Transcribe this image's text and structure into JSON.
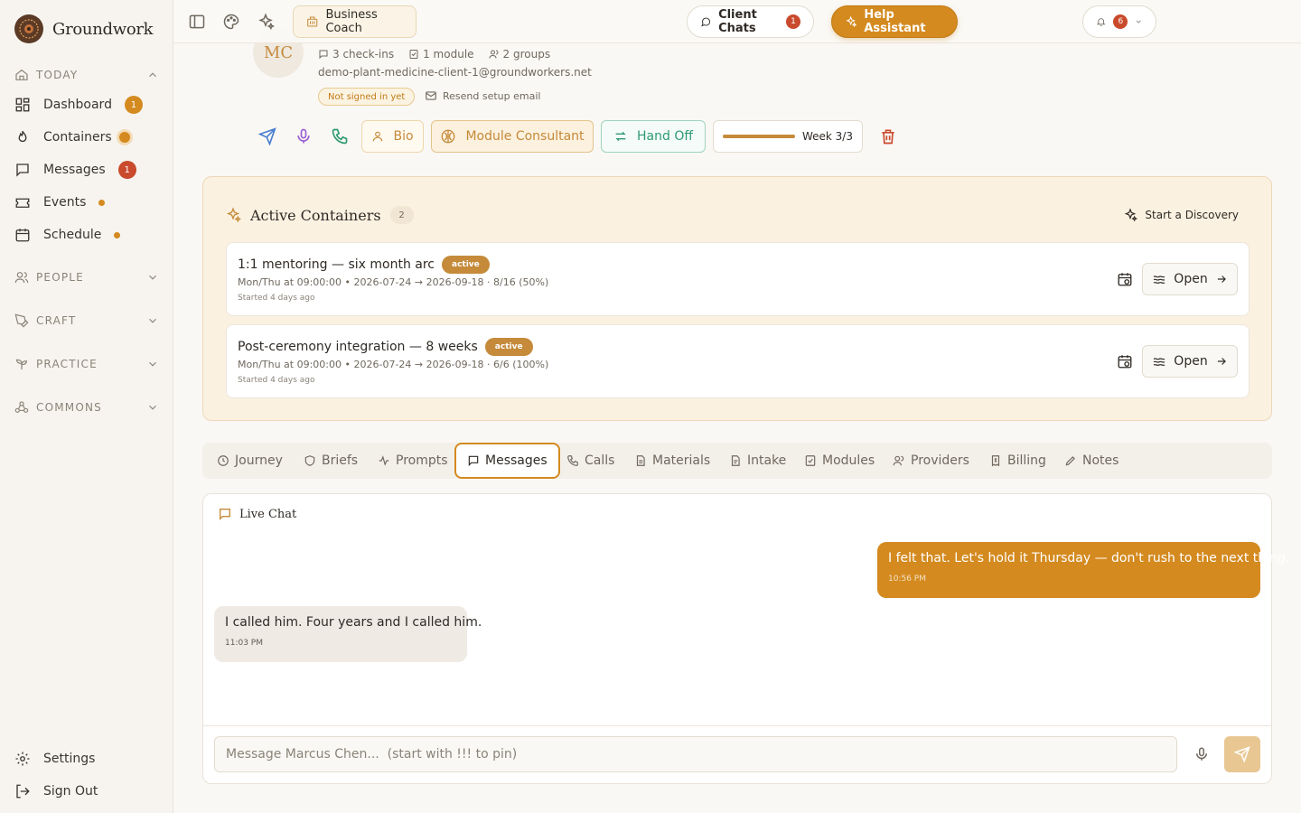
{
  "brand": {
    "name": "Groundwork"
  },
  "sidebar": {
    "sections": {
      "today": "TODAY",
      "people": "PEOPLE",
      "craft": "CRAFT",
      "practice": "PRACTICE",
      "commons": "COMMONS"
    },
    "items": [
      {
        "label": "Dashboard",
        "badge": "1"
      },
      {
        "label": "Containers"
      },
      {
        "label": "Messages",
        "badge": "1"
      },
      {
        "label": "Events"
      },
      {
        "label": "Schedule"
      }
    ],
    "footer": {
      "settings": "Settings",
      "signout": "Sign Out"
    }
  },
  "topbar": {
    "role": "Business Coach",
    "client_chats": "Client Chats",
    "client_chats_count": "1",
    "help": "Help Assistant",
    "notifications": "6"
  },
  "client": {
    "initials": "MC",
    "checkins": "3 check-ins",
    "modules": "1 module",
    "groups": "2 groups",
    "email": "demo-plant-medicine-client-1@groundworkers.net",
    "status": "Not signed in yet",
    "resend": "Resend setup email"
  },
  "actions": {
    "bio": "Bio",
    "module_consultant": "Module Consultant",
    "hand_off": "Hand Off",
    "week": "Week 3/3",
    "week_progress": 1.0
  },
  "containers": {
    "title": "Active Containers",
    "count": "2",
    "discovery": "Start a Discovery",
    "items": [
      {
        "name": "1:1 mentoring — six month arc",
        "status": "active",
        "schedule": "Mon/Thu at 09:00:00 • 2026-07-24 → 2026-09-18 · 8/16 (50%)",
        "started": "Started 4 days ago",
        "open": "Open"
      },
      {
        "name": "Post-ceremony integration — 8 weeks",
        "status": "active",
        "schedule": "Mon/Thu at 09:00:00 • 2026-07-24 → 2026-09-18 · 6/6 (100%)",
        "started": "Started 4 days ago",
        "open": "Open"
      }
    ]
  },
  "tabs": [
    "Journey",
    "Briefs",
    "Prompts",
    "Messages",
    "Calls",
    "Materials",
    "Intake",
    "Modules",
    "Providers",
    "Billing",
    "Notes"
  ],
  "chat": {
    "title": "Live Chat",
    "messages": [
      {
        "text": "I felt that. Let's hold it Thursday — don't rush to the next thing.",
        "time": "10:56 PM",
        "direction": "out"
      },
      {
        "text": "I called him. Four years and I called him.",
        "time": "11:03 PM",
        "direction": "in"
      }
    ],
    "placeholder": "Message Marcus Chen...  (start with !!! to pin)"
  },
  "colors": {
    "accent": "#d48a1f",
    "badge_red": "#c94a2c",
    "handoff": "#2e9a72"
  }
}
